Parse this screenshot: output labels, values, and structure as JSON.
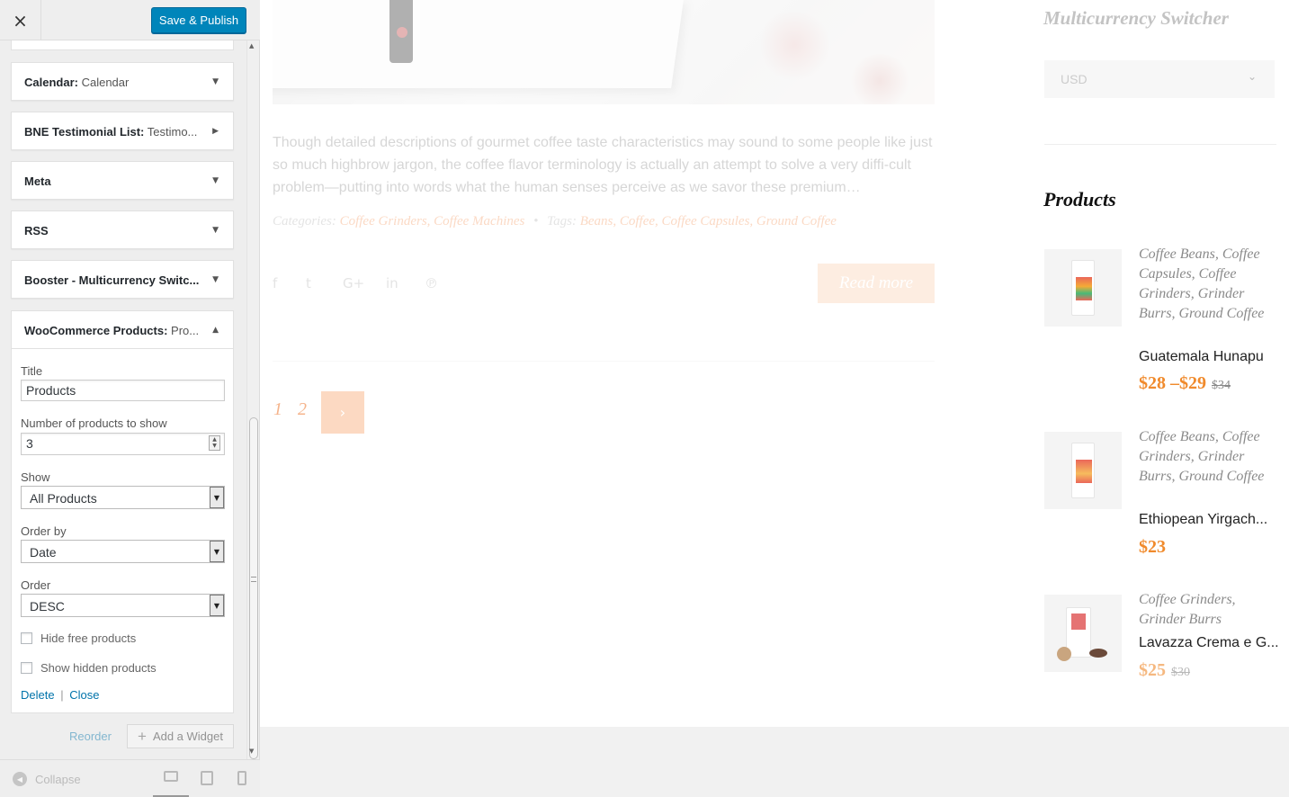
{
  "toolbar": {
    "close_label": "×",
    "publish_label": "Save & Publish"
  },
  "widgets": [
    {
      "name": "Calendar:",
      "sub": " Calendar",
      "arrow": "▼"
    },
    {
      "name": "BNE Testimonial List:",
      "sub": " Testimo...",
      "arrow": "▶"
    },
    {
      "name": "Meta",
      "sub": "",
      "arrow": "▼"
    },
    {
      "name": "RSS",
      "sub": "",
      "arrow": "▼"
    },
    {
      "name": "Booster - Multicurrency Switc...",
      "sub": "",
      "arrow": "▼"
    }
  ],
  "open_widget": {
    "name": "WooCommerce Products:",
    "sub": " Pro...",
    "arrow": "▲",
    "title_label": "Title",
    "title_value": "Products",
    "number_label": "Number of products to show",
    "number_value": "3",
    "show_label": "Show",
    "show_value": "All Products",
    "orderby_label": "Order by",
    "orderby_value": "Date",
    "order_label": "Order",
    "order_value": "DESC",
    "hide_free_label": "Hide free products",
    "show_hidden_label": "Show hidden products",
    "delete_label": "Delete",
    "separator": "|",
    "close_label": "Close"
  },
  "footer": {
    "reorder_label": "Reorder",
    "add_widget_label": "Add a Widget",
    "collapse_label": "Collapse"
  },
  "preview": {
    "excerpt": "Though detailed descriptions of gourmet coffee taste characteristics may sound to some people like just so much highbrow jargon,  the coffee flavor terminology is actually an attempt to solve a very diffi-cult problem—putting into  words what the human senses perceive as we  savor these premium…",
    "categories_label": "Categories:",
    "categories": "Coffee Grinders, Coffee Machines",
    "bullet": "•",
    "tags_label": "Tags:",
    "tags": "Beans, Coffee, Coffee Capsules, Ground Coffee",
    "read_more": "Read more",
    "pages": [
      "1",
      "2"
    ],
    "next": "›"
  },
  "right_sidebar": {
    "currency_title": "Multicurrency Switcher",
    "currency_value": "USD",
    "products_title": "Products",
    "products": [
      {
        "cats": "Coffee Beans, Coffee Capsules, Coffee Grinders, Grinder Burrs, Ground Coffee",
        "name": "Guatemala Hunapu",
        "price": "$28 –$29",
        "old_price": "$34"
      },
      {
        "cats": "Coffee Beans, Coffee Grinders, Grinder Burrs, Ground Coffee",
        "name": "Ethiopean Yirgach...",
        "price": "$23",
        "old_price": ""
      },
      {
        "cats": "Coffee Grinders, Grinder Burrs",
        "name": "Lavazza Crema e G...",
        "price": "$25",
        "old_price": "$30"
      }
    ]
  },
  "colors": {
    "primary_button": "#0085ba",
    "accent": "#f08a2c",
    "link": "#0073aa"
  }
}
